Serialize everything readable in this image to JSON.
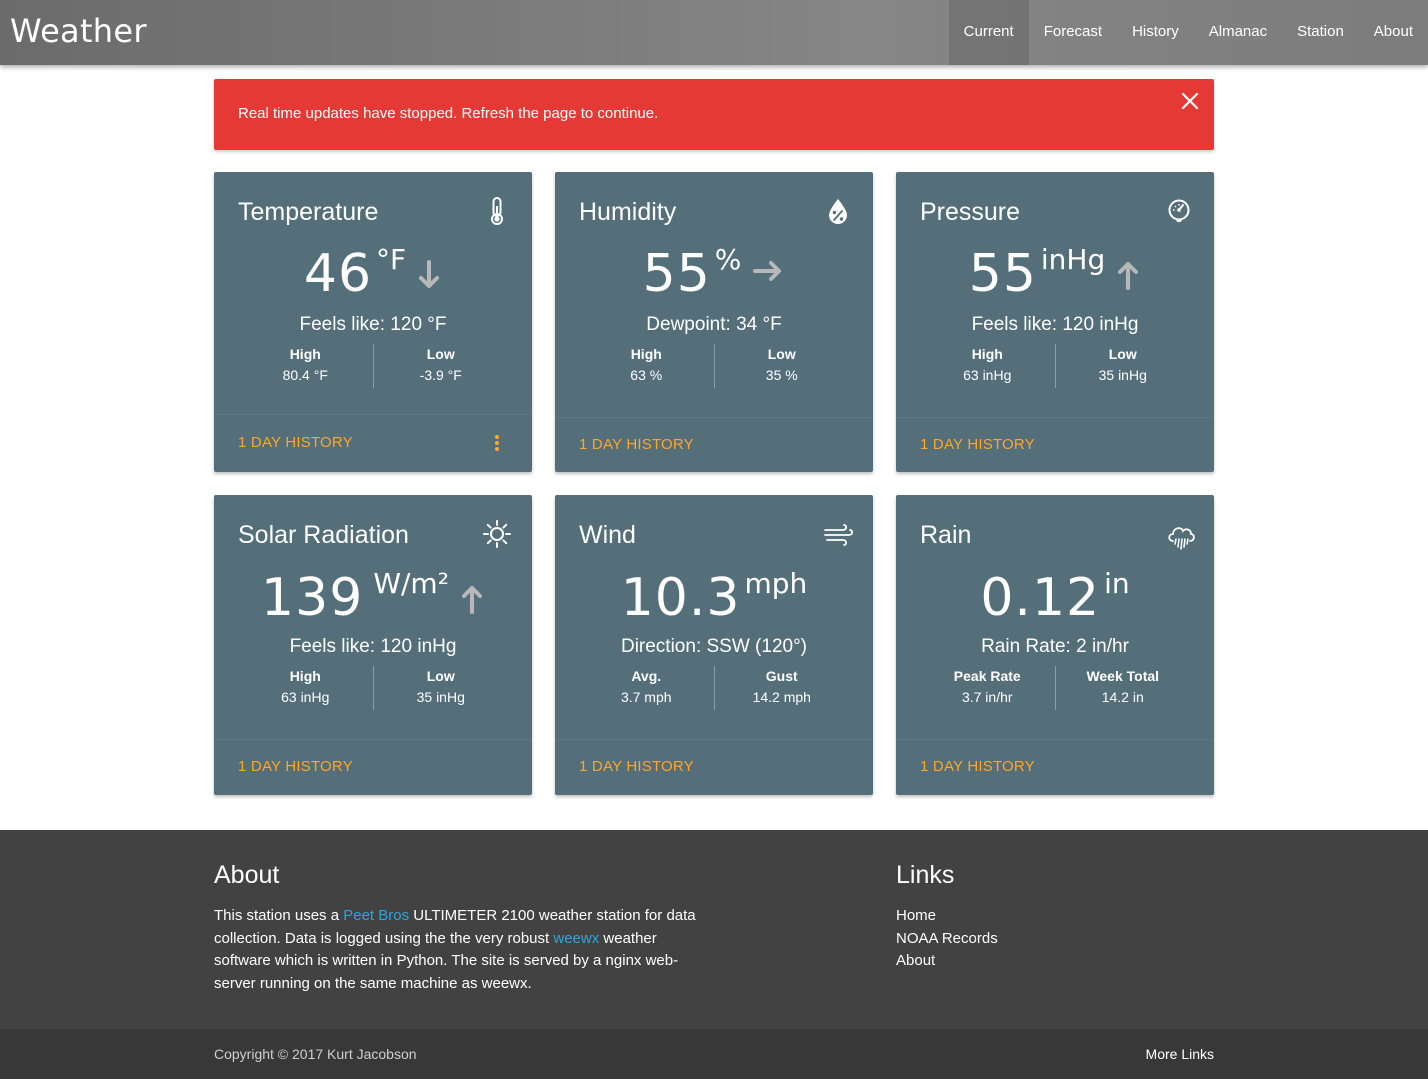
{
  "app": {
    "brand": "Weather"
  },
  "nav": [
    {
      "label": "Current",
      "active": true
    },
    {
      "label": "Forecast"
    },
    {
      "label": "History"
    },
    {
      "label": "Almanac"
    },
    {
      "label": "Station"
    },
    {
      "label": "About"
    }
  ],
  "alert": {
    "text": "Real time updates have stopped. Refresh the page to continue.",
    "color": "#e53935"
  },
  "colors": {
    "card": "#546e7a",
    "link": "#ffa726",
    "footer": "#424242"
  },
  "cards": [
    {
      "title": "Temperature",
      "icon": "thermometer-icon",
      "value": "46",
      "unit": "°F",
      "trend": "down",
      "sub": "Feels like: 120 °F",
      "stats": [
        {
          "label": "High",
          "value": "80.4 °F"
        },
        {
          "label": "Low",
          "value": "-3.9 °F"
        }
      ],
      "history": "1 DAY HISTORY"
    },
    {
      "title": "Humidity",
      "icon": "humidity-icon",
      "value": "55",
      "unit": "%",
      "trend": "steady",
      "sub": "Dewpoint: 34 °F",
      "stats": [
        {
          "label": "High",
          "value": "63 %"
        },
        {
          "label": "Low",
          "value": "35 %"
        }
      ],
      "history": "1 DAY HISTORY"
    },
    {
      "title": "Pressure",
      "icon": "gauge-icon",
      "value": "55",
      "unit": "inHg",
      "trend": "up",
      "sub": "Feels like: 120 inHg",
      "stats": [
        {
          "label": "High",
          "value": "63 inHg"
        },
        {
          "label": "Low",
          "value": "35 inHg"
        }
      ],
      "history": "1 DAY HISTORY"
    },
    {
      "title": "Solar Radiation",
      "icon": "sun-icon",
      "value": "139",
      "unit": "W/m²",
      "trend": "up",
      "sub": "Feels like: 120 inHg",
      "stats": [
        {
          "label": "High",
          "value": "63 inHg"
        },
        {
          "label": "Low",
          "value": "35 inHg"
        }
      ],
      "history": "1 DAY HISTORY"
    },
    {
      "title": "Wind",
      "icon": "wind-icon",
      "value": "10.3",
      "unit": "mph",
      "sub": "Direction: SSW (120°)",
      "stats": [
        {
          "label": "Avg.",
          "value": "3.7 mph"
        },
        {
          "label": "Gust",
          "value": "14.2 mph"
        }
      ],
      "history": "1 DAY HISTORY"
    },
    {
      "title": "Rain",
      "icon": "rain-cloud-icon",
      "value": "0.12",
      "unit": "in",
      "sub": "Rain Rate: 2 in/hr",
      "stats": [
        {
          "label": "Peak Rate",
          "value": "3.7 in/hr"
        },
        {
          "label": "Week Total",
          "value": "14.2 in"
        }
      ],
      "history": "1 DAY HISTORY"
    }
  ],
  "footer": {
    "about_heading": "About",
    "about": {
      "t1": "This station uses a ",
      "link1": "Peet Bros",
      "t2": " ULTIMETER 2100 weather station for data collection. Data is logged using the the very robust ",
      "link2": "weewx",
      "t3": " weather software which is written in Python. The site is served by a nginx web-server running on the same machine as weewx."
    },
    "links_heading": "Links",
    "links": [
      "Home",
      "NOAA Records",
      "About"
    ],
    "copyright": "Copyright © 2017 Kurt Jacobson",
    "more_links": "More Links"
  }
}
